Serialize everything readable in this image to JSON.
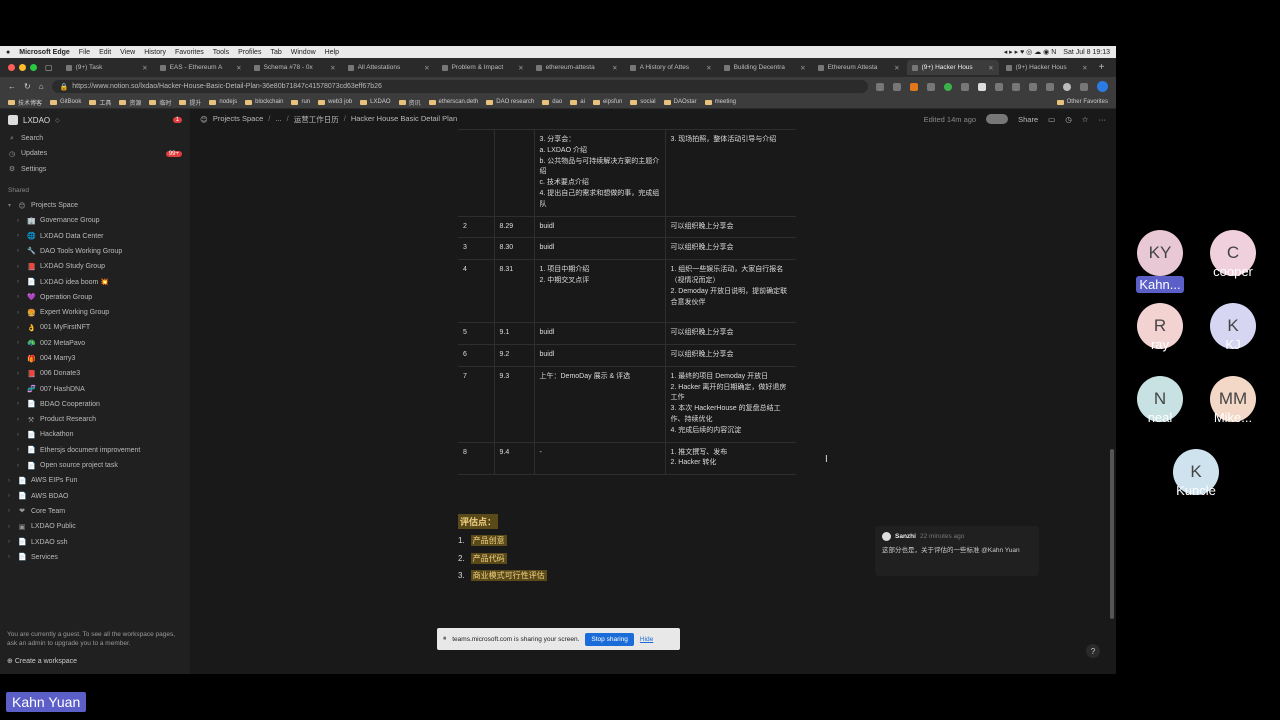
{
  "menubar": {
    "app": "Microsoft Edge",
    "items": [
      "File",
      "Edit",
      "View",
      "History",
      "Favorites",
      "Tools",
      "Profiles",
      "Tab",
      "Window",
      "Help"
    ],
    "clock": "Sat Jul 8  19:13"
  },
  "tabs": [
    {
      "label": "(9+) Task"
    },
    {
      "label": "EAS - Ethereum A"
    },
    {
      "label": "Schema #78 - 0x"
    },
    {
      "label": "All Attestations"
    },
    {
      "label": "Problem & Impact"
    },
    {
      "label": "ethereum-attesta"
    },
    {
      "label": "A History of Attes"
    },
    {
      "label": "Building Decentra"
    },
    {
      "label": "Ethereum Attesta"
    },
    {
      "label": "(9+) Hacker Hous",
      "active": true
    },
    {
      "label": "(9+) Hacker Hous"
    }
  ],
  "url": "https://www.notion.so/lxdao/Hacker-House-Basic-Detail-Plan-36e80b71847c41578073cd63eff67b26",
  "bookmarks": [
    "技术博客",
    "GitBook",
    "工具",
    "资源",
    "临时",
    "提升",
    "nodejs",
    "blockchain",
    "run",
    "web3 job",
    "LXDAO",
    "资讯",
    "etherscan.deth",
    "DAO research",
    "dao",
    "ai",
    "eipsfun",
    "social",
    "DAOstar",
    "meeting"
  ],
  "bookmarks_other": "Other Favorites",
  "sidebar": {
    "workspace": "LXDAO",
    "workspace_badge": "1",
    "search": "Search",
    "updates": "Updates",
    "updates_badge": "99+",
    "settings": "Settings",
    "shared_label": "Shared",
    "items": [
      {
        "label": "Projects Space",
        "icon": "😊",
        "level": 0,
        "open": true
      },
      {
        "label": "Governance Group",
        "icon": "🏢",
        "level": 1
      },
      {
        "label": "LXDAO Data Center",
        "icon": "🌐",
        "level": 1
      },
      {
        "label": "DAO Tools Working Group",
        "icon": "🔧",
        "level": 1
      },
      {
        "label": "LXDAO Study Group",
        "icon": "📕",
        "level": 1
      },
      {
        "label": "LXDAO idea boom 💥",
        "icon": "📄",
        "level": 1
      },
      {
        "label": "Operation Group",
        "icon": "💜",
        "level": 1
      },
      {
        "label": "Expert Working Group",
        "icon": "🍔",
        "level": 1
      },
      {
        "label": "001 MyFirstNFT",
        "icon": "👌",
        "level": 1
      },
      {
        "label": "002 MetaPavo",
        "icon": "🦚",
        "level": 1
      },
      {
        "label": "004 Marry3",
        "icon": "🎁",
        "level": 1
      },
      {
        "label": "006 Donate3",
        "icon": "📕",
        "level": 1
      },
      {
        "label": "007 HashDNA",
        "icon": "🧬",
        "level": 1
      },
      {
        "label": "BDAO Cooperation",
        "icon": "📄",
        "level": 1
      },
      {
        "label": "Product Research",
        "icon": "⚒",
        "level": 1
      },
      {
        "label": "Hackathon",
        "icon": "📄",
        "level": 1
      },
      {
        "label": "Ethersjs document improvement",
        "icon": "📄",
        "level": 1
      },
      {
        "label": "Open source project task",
        "icon": "📄",
        "level": 1
      },
      {
        "label": "AWS EIPs Fun",
        "icon": "📄",
        "level": 0
      },
      {
        "label": "AWS BDAO",
        "icon": "📄",
        "level": 0
      },
      {
        "label": "Core Team",
        "icon": "❤",
        "level": 0
      },
      {
        "label": "LXDAO Public",
        "icon": "▣",
        "level": 0
      },
      {
        "label": "LXDAO ssh",
        "icon": "📄",
        "level": 0
      },
      {
        "label": "Services",
        "icon": "📄",
        "level": 0
      }
    ],
    "guest_note": "You are currently a guest. To see all the workspace pages, ask an admin to upgrade you to a member.",
    "create_workspace": "Create a workspace"
  },
  "topbar": {
    "crumbs": [
      "Projects Space",
      "...",
      "运营工作日历",
      "Hacker House Basic Detail Plan"
    ],
    "edited": "Edited 14m ago",
    "share": "Share"
  },
  "schedule": {
    "rows": [
      {
        "num": "",
        "date": "",
        "content": "3. 分享会：\na. LXDAO 介绍\nb. 公共物品与可持续解决方案的主题介绍\nc. 技术要点介绍\n4. 提出自己的需求和想做的事，完成组队",
        "note": "3. 现场拍照，整体活动引导与介绍",
        "h": 86
      },
      {
        "num": "2",
        "date": "8.29",
        "content": "buidl",
        "note": "可以组织晚上分享会",
        "h": 19
      },
      {
        "num": "3",
        "date": "8.30",
        "content": "buidl",
        "note": "可以组织晚上分享会",
        "h": 19
      },
      {
        "num": "4",
        "date": "8.31",
        "content": "1. 项目中期介绍\n2. 中期交叉点评",
        "note": "1. 组织一些娱乐活动，大家自行报名（视情况而定）\n2. Demoday 开放日说明，提前确定联合意发伙伴",
        "h": 63
      },
      {
        "num": "5",
        "date": "9.1",
        "content": "buidl",
        "note": "可以组织晚上分享会",
        "h": 19
      },
      {
        "num": "6",
        "date": "9.2",
        "content": "buidl",
        "note": "可以组织晚上分享会",
        "h": 19
      },
      {
        "num": "7",
        "date": "9.3",
        "content": "上午：DemoDay 展示 & 评选",
        "note": "1. 最终的项目 Demoday 开放日\n2. Hacker 离开的日期确定，做好退房工作\n3. 本次 HackerHouse 的复盘总结工作、持续优化\n4. 完成后续的内容沉淀",
        "h": 73
      },
      {
        "num": "8",
        "date": "9.4",
        "content": "-",
        "note": "1. 推文撰写、发布\n2. Hacker 转化",
        "h": 31
      }
    ]
  },
  "evaluation": {
    "title": "评估点：",
    "items": [
      "产品创意",
      "产品代码",
      "商业模式可行性评估"
    ]
  },
  "comment": {
    "author": "Sanzhi",
    "time": "22 minutes ago",
    "body": "这部分也是，关于评估的一些标准 @Kahn Yuan"
  },
  "sharing": {
    "text": "teams.microsoft.com is sharing your screen.",
    "stop": "Stop sharing",
    "hide": "Hide"
  },
  "participants": [
    {
      "initials": "KY",
      "name": "Kahn...",
      "color": "#e8c8d4",
      "highlight": true
    },
    {
      "initials": "C",
      "name": "cooper",
      "color": "#f0d0dc"
    },
    {
      "initials": "R",
      "name": "ray",
      "color": "#f3d2d2"
    },
    {
      "initials": "K",
      "name": "KJ",
      "color": "#d6d6f2"
    },
    {
      "initials": "N",
      "name": "neal",
      "color": "#c8e2e4"
    },
    {
      "initials": "MM",
      "name": "Mike...",
      "color": "#f3d8c8"
    },
    {
      "initials": "K",
      "name": "Kuncle",
      "color": "#cfe3ef"
    }
  ],
  "presenter": "Kahn Yuan",
  "colors": {
    "accent": "#5b5fc7",
    "highlight_bg": "#5a4a1a",
    "highlight_text": "#f0d080",
    "notion_bg": "#191919"
  }
}
